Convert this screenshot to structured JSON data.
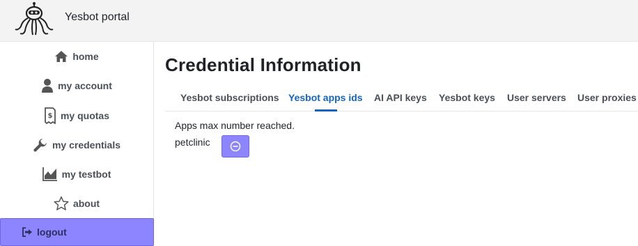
{
  "header": {
    "brand": "Yesbot portal",
    "logo_icon": "octopus-robot-logo"
  },
  "sidebar": {
    "items": [
      {
        "label": "home",
        "icon": "home-icon"
      },
      {
        "label": "my account",
        "icon": "user-icon"
      },
      {
        "label": "my quotas",
        "icon": "receipt-icon"
      },
      {
        "label": "my credentials",
        "icon": "wrench-icon"
      },
      {
        "label": "my testbot",
        "icon": "chart-icon"
      },
      {
        "label": "about",
        "icon": "star-icon"
      }
    ],
    "logout_label": "logout",
    "accent": "#8c85ff"
  },
  "main": {
    "title": "Credential Information",
    "tabs": [
      {
        "label": "Yesbot subscriptions",
        "active": false
      },
      {
        "label": "Yesbot apps ids",
        "active": true
      },
      {
        "label": "AI API keys",
        "active": false
      },
      {
        "label": "Yesbot keys",
        "active": false
      },
      {
        "label": "User servers",
        "active": false
      },
      {
        "label": "User proxies",
        "active": false
      }
    ],
    "status_message": "Apps max number reached.",
    "apps": [
      {
        "name": "petclinic",
        "action_icon": "remove-circle-icon"
      }
    ],
    "active_tab_color": "#1565c0"
  }
}
